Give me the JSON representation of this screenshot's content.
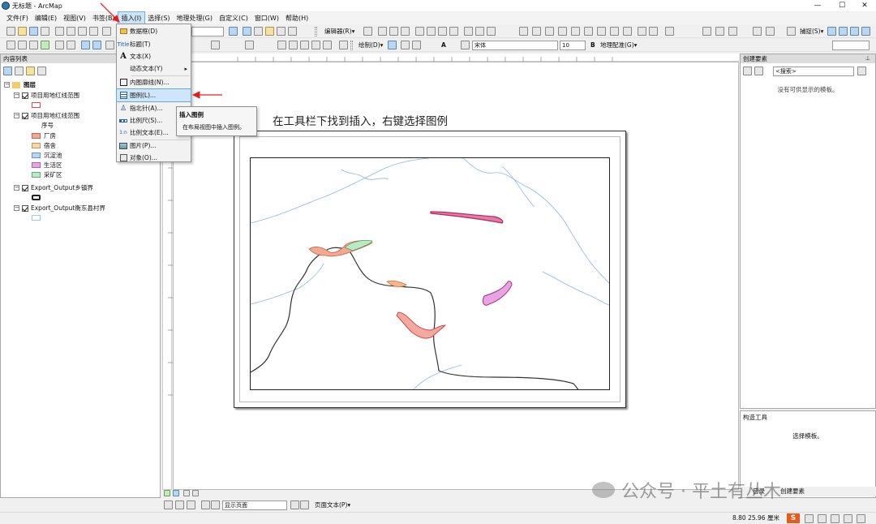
{
  "window": {
    "title": "无标题 - ArcMap",
    "min": "—",
    "max": "☐",
    "close": "✕"
  },
  "menubar": [
    "文件(F)",
    "编辑(E)",
    "视图(V)",
    "书签(B)",
    "插入(I)",
    "选择(S)",
    "地理处理(G)",
    "自定义(C)",
    "窗口(W)",
    "帮助(H)"
  ],
  "toolbar": {
    "editor": "编辑器(R)▾",
    "capture": "捕捉(S)▾",
    "draw": "绘制(D)▾",
    "font": "宋体",
    "font_size": "10",
    "georef": "地理配准(G)▾",
    "text_A": "A"
  },
  "insert_menu": [
    {
      "label": "数据框(D)",
      "icon": "data-frame-icon"
    },
    {
      "label": "标题(T)",
      "icon": "title-icon"
    },
    {
      "label": "文本(X)",
      "icon": "text-icon"
    },
    {
      "label": "动态文本(Y)",
      "icon": "dynamic-text-icon",
      "submenu": "▸"
    },
    {
      "label": "内图廓线(N)...",
      "icon": "neatline-icon"
    },
    {
      "label": "图例(L)...",
      "icon": "legend-icon",
      "selected": true
    },
    {
      "label": "指北针(A)...",
      "icon": "north-arrow-icon"
    },
    {
      "label": "比例尺(S)...",
      "icon": "scale-bar-icon"
    },
    {
      "label": "比例文本(E)...",
      "icon": "scale-text-icon"
    },
    {
      "label": "图片(P)...",
      "icon": "picture-icon"
    },
    {
      "label": "对象(O)...",
      "icon": "object-icon"
    }
  ],
  "tooltip": {
    "title": "插入图例",
    "body": "在布局视图中插入图例。"
  },
  "toc": {
    "header": "内容列表",
    "layers_root": "图层",
    "layers": [
      {
        "name": "项目用地红线范围",
        "swatch_color": "#e8a0a0"
      },
      {
        "name": "项目用地红线范围",
        "field": "序号",
        "classes": [
          {
            "label": "厂房",
            "color": "#f2a98d"
          },
          {
            "label": "宿舍",
            "color": "#f6d6a4"
          },
          {
            "label": "沉淀池",
            "color": "#b7d7f0"
          },
          {
            "label": "生活区",
            "color": "#e7a3e3"
          },
          {
            "label": "采矿区",
            "color": "#b9eac4"
          }
        ]
      },
      {
        "name": "Export_Output乡镇界"
      },
      {
        "name": "Export_Output衡东县村界"
      }
    ]
  },
  "annotation": "在工具栏下找到插入，右键选择图例",
  "right_panel": {
    "header": "创建要素",
    "search": "<搜索>",
    "empty": "没有可供显示的模板。",
    "construct_header": "构造工具",
    "construct_body": "选择模板。",
    "tab1": "目录",
    "tab2": "创建要素"
  },
  "layout_bar": {
    "page": "显示页面",
    "page_text": "页面文本(P)▾"
  },
  "status": {
    "coords": "8.80  25.96 厘米"
  },
  "watermark": "公众号 · 平土有丛木",
  "colors": {
    "menu_highlight": "#cfe6fa",
    "red_arrow": "#e02020",
    "boundary": "#333333",
    "river": "#8ab8ea"
  }
}
